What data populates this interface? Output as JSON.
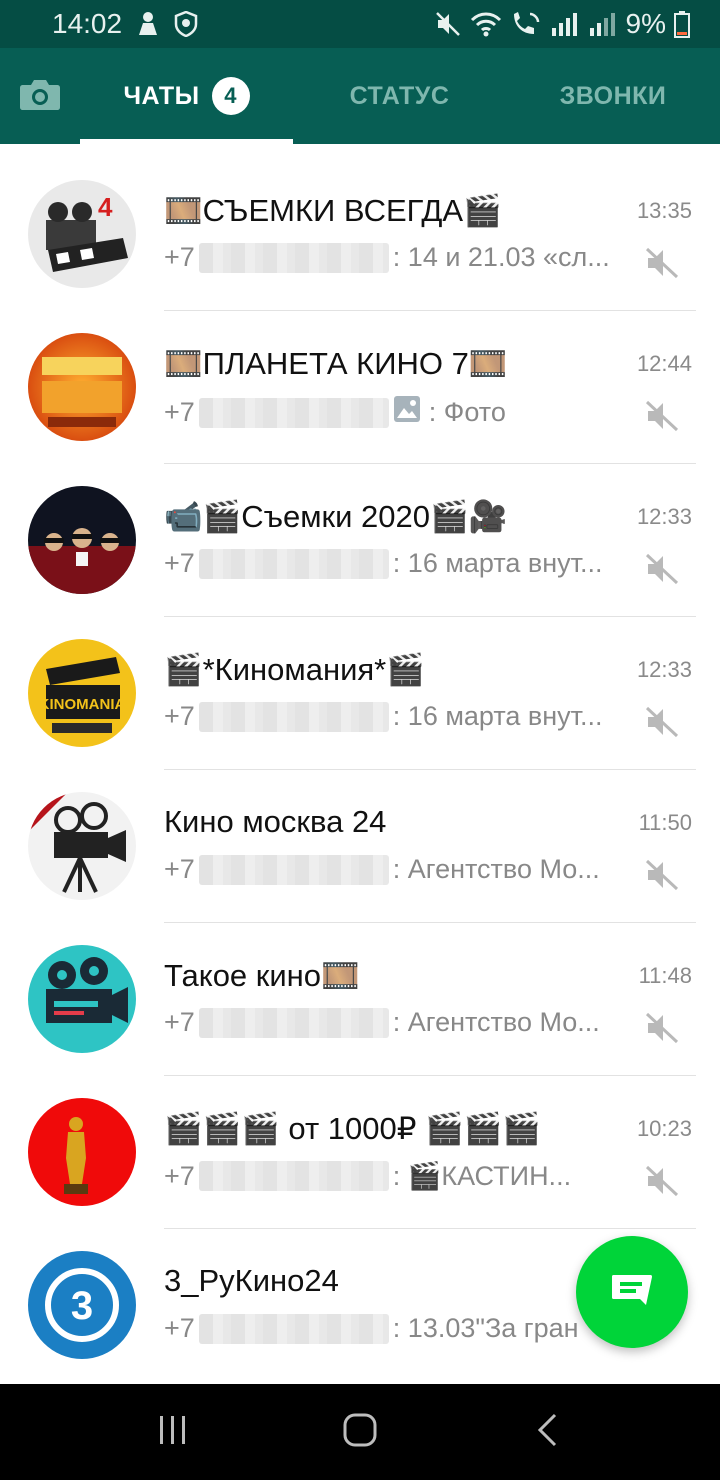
{
  "status_bar": {
    "time": "14:02",
    "battery": "9%",
    "icons": [
      "person-icon",
      "shield-icon",
      "mute-icon",
      "wifi-icon",
      "wifi-call-icon",
      "signal-icon",
      "battery-icon"
    ]
  },
  "tabs": {
    "camera_icon": "camera-icon",
    "chats": "ЧАТЫ",
    "chats_badge": "4",
    "status": "СТАТУС",
    "calls": "ЗВОНКИ"
  },
  "chats": [
    {
      "name": "🎞️СЪЕМКИ ВСЕГДА🎬",
      "time": "13:35",
      "prefix": "+7",
      "text": ": 14 и 21.03 «сл...",
      "muted": true
    },
    {
      "name": "🎞️ПЛАНЕТА КИНО 7🎞️",
      "time": "12:44",
      "prefix": "+7",
      "text": ": Фото",
      "muted": true
    },
    {
      "name": "📹🎬Съемки 2020🎬🎥",
      "time": "12:33",
      "prefix": "+7",
      "text": ": 16 марта внут...",
      "muted": true
    },
    {
      "name": "🎬*Киномания*🎬",
      "time": "12:33",
      "prefix": "+7",
      "text": ": 16 марта внут...",
      "muted": true
    },
    {
      "name": "Кино москва 24",
      "time": "11:50",
      "prefix": "+7",
      "text": ": Агентство Мо...",
      "muted": true
    },
    {
      "name": "Такое кино🎞️",
      "time": "11:48",
      "prefix": "+7",
      "text": ": Агентство Мо...",
      "muted": true
    },
    {
      "name": "🎬🎬🎬 от 1000₽ 🎬🎬🎬",
      "time": "10:23",
      "prefix": "+7",
      "text": ": 🎬КАСТИН...",
      "muted": true
    },
    {
      "name": "3_РуКино24",
      "time": "",
      "prefix": "+7",
      "text": ": 13.03\"За гран",
      "muted": true
    }
  ],
  "fab": {
    "icon": "new-chat-icon"
  },
  "colors": {
    "header": "#075e54",
    "status_bar": "#054d44",
    "fab": "#00d439",
    "muted_text": "#888888"
  }
}
